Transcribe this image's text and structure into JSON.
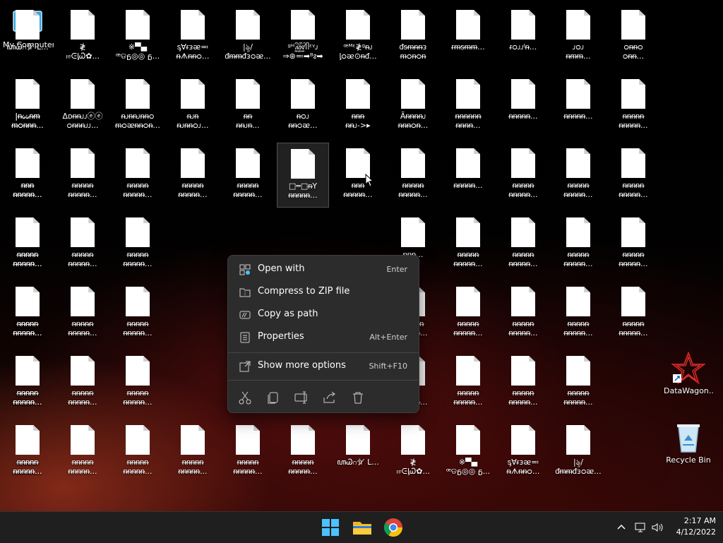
{
  "colors": {
    "accent": "#4cc2ff",
    "menu_bg": "#2c2c2c",
    "taskbar_bg": "#1f1f1f"
  },
  "desktop": {
    "special": [
      {
        "key": "my-computer",
        "label": "My Computer",
        "icon": "monitor-icon"
      },
      {
        "key": "datawagon",
        "label": "DataWagon...",
        "icon": "datawagon-shortcut-icon"
      },
      {
        "key": "recycle-bin",
        "label": "Recycle Bin",
        "icon": "recycle-bin-icon"
      }
    ],
    "files": [
      "ꦲᏊဂ݅ᥟ ̸ ᒪ...",
      "≹\nஈᕮᶅᏇ✿...",
      "※▀▄\nꟹଡᵷ◎◎ ᵷ...",
      "ᶊ∀ᵲᴈᴂ≕\nᵰᗑᵰᵰᴑ...",
      "|ৡ/\nᵭᵯᵯᵭᴈᴑᴂ...",
      "ᵍᴴ꫞ᥥᵋᵞᴊ\n⇒⊛≕➡ᴮᴤ➡",
      "ꟹᴹᵋ≹ᵍᵰᴊ\nᶅᴑᴂ⊙ᵰᵭ...",
      "ᵭᵴᵯᵰᵰᴈ\nᵯᴑᵰᴑᵰ",
      "ᵲᵯᵴᵯᵯ...",
      "ᵲᴑᴊᴊᴵᵰ...",
      "ᴊᴑᴊ\nᵰᵯᵯ...",
      "ᴑᵰᵰᴑ\nᴑᵰᵰ...",
      "|ᵰ᥀᥀ᵰᵯ\nᵯᴑᵰᵰᵰ...",
      "Δᴅᵰᵰᴊᴊⓔⓔ\nᴑᵰᵰᵰᴊᴊ...",
      "ᵰᴊᵰᵰᴊᵰᵰᴑ\nᵯᴑᴂᵰᵰᴑᵰ...",
      "ᵰᴊᵰ\nᵰᴊᵰᵰᴑᴊ...",
      "ᵰᵰ\nᵰᵰᴊᵰ...",
      "ᵰᴑᴊ\nᵰᵰᴑᴂ...",
      "ᵰᵰᵰ\nᵰᵰᴊ->▸",
      "Ãᵰᵰᵰᵰᴊ\nᵰᵰᵰᴑᵰ...",
      "ᵰᵰᵰᵰᵰᵰ\nᵰᵰᵰᵰ...",
      "ᵰᵰᵰᵰᵰ...",
      "ᵰᵰᵰᵰᵰ...",
      "ᵰᵰᵰᵰᵰ\nᵰᵰᵰᵰᵰ...",
      "ᵰᵰᵰ\nᵰᵰᵰᵰᵰ...",
      "ᵰᵰᵰᵰᵰ\nᵰᵰᵰᵰᵰ...",
      "ᵰᵰᵰᵰᵰ\nᵰᵰᵰᵰᵰ...",
      "ᵰᵰᵰᵰᵰ\nᵰᵰᵰᵰᵰ...",
      "ᵰᵰᵰᵰᵰ\nᵰᵰᵰᵰᵰ...",
      "□═□ᵰY\nᵰᵰᵰᵰᵰ...",
      "ᵰᵰᵰ\nᵰᵰᵰᵰᵰ...",
      "ᵰᵰᵰᵰᵰ\nᵰᵰᵰᵰᵰ...",
      "ᵰᵰᵰᵰᵰ...",
      "ᵰᵰᵰᵰᵰ\nᵰᵰᵰᵰᵰ...",
      "ᵰᵰᵰᵰᵰ\nᵰᵰᵰᵰᵰ...",
      "ᵰᵰᵰᵰᵰ\nᵰᵰᵰᵰᵰ...",
      "ᵰᵰᵰᵰᵰ\nᵰᵰᵰᵰᵰ...",
      "ᵰᵰᵰᵰᵰ\nᵰᵰᵰᵰᵰ...",
      "ᵰᵰᵰᵰᵰ\nᵰᵰᵰᵰᵰ...",
      "ᵰᵰᵰᵰᵰ\nᵰᵰᵰᵰᵰ...",
      "ᵰᵰᵰ...",
      "ᵰᵰᵰ...",
      "ᵰᵰᵰ...",
      "ᵰᵰᵰ...",
      "ᵰᵰᵰᵰᵰ\nᵰᵰᵰᵰᵰ...",
      "ᵰᵰᵰᵰᵰ\nᵰᵰᵰᵰᵰ...",
      "ᵰᵰᵰᵰᵰ\nᵰᵰᵰᵰᵰ...",
      "ᵰᵰᵰᵰᵰ\nᵰᵰᵰᵰᵰ...",
      "ᵰᵰᵰᵰᵰ\nᵰᵰᵰᵰᵰ...",
      "ᵰᵰᵰᵰᵰ\nᵰᵰᵰᵰᵰ...",
      "ᵰᵰᵰᵰᵰ\nᵰᵰᵰᵰᵰ...",
      "ᵰᵰᵰᵰᵰ\nᵰᵰᵰᵰᵰ...",
      "ᵰᵰᵰᵰᵰ\nᵰᵰᵰᵰᵰ...",
      "ᵰᵰᵰᵰᵰ\nᵰᵰᵰᵰᵰ...",
      "ᵰᵰᵰᵰᵰ\nᵰᵰᵰᵰᵰ...",
      "ᵰᵰᵰᵰᵰ\nᵰᵰᵰᵰᵰ...",
      "ᵰᵰᵰᵰᵰ\nᵰᵰᵰᵰᵰ...",
      "ᵰᵰᵰᵰᵰ\nᵰᵰᵰᵰᵰ...",
      "ᵰᵰᵰᵰᵰ\nᵰᵰᵰᵰᵰ...",
      "ᵰᵰᵰᵰᵰ\nᵰᵰᵰᵰᵰ...",
      "ᵰᵰᵰᵰᵰ\nᵰᵰᵰᵰᵰ...",
      "ᵰᵰᵰᵰᵰ\nᵰᵰᵰᵰᵰ...",
      "ᵰᵰᵰᵰᵰ\nᵰᵰᵰᵰᵰ...",
      "ᵰᵰᵰᵰᵰ\nᵰᵰᵰᵰᵰ...",
      "ᵰᵰᵰᵰᵰ\nᵰᵰᵰᵰᵰ...",
      "DataWagon...",
      "ᵰᵰᵰᵰᵰ\nᵰᵰᵰᵰᵰ...",
      "≠\nᵰᵰᵰᵰᵰ...",
      "ᵰᵰᵰᵰᵰ\nᵰᵰᵰᵰᵰ...",
      "ᵰᵰᵰᵰᵰ\nᵰᵰᵰᵰᵰ...",
      "ᵰᵰᵰᵰᵰ\nᵰᵰᵰᵰᵰ...",
      "ᵰᵰᵰᵰᵰ\nᵰᵰᵰᵰᵰ...",
      "ᵰᵰᵰᵰᵰ\nᵰᵰᵰᵰᵰ...",
      "ᵰᵰᵰᵰᵰ\nᵰᵰᵰᵰᵰ...",
      "ᵰᵰᵰᵰᵰ\nᵰᵰᵰᵰᵰ...",
      "ᵰᵰᵰᵰᵰ\nᵰᵰᵰᵰᵰ...",
      "ᵰᵰᵰᵰᵰ\nᵰᵰᵰᵰᵰ..."
    ]
  },
  "context_menu": {
    "items": [
      {
        "label": "Open with",
        "shortcut": "Enter",
        "icon": "open-with-icon"
      },
      {
        "label": "Compress to ZIP file",
        "shortcut": "",
        "icon": "zip-folder-icon"
      },
      {
        "label": "Copy as path",
        "shortcut": "",
        "icon": "copy-path-icon"
      },
      {
        "label": "Properties",
        "shortcut": "Alt+Enter",
        "icon": "properties-icon"
      }
    ],
    "more": {
      "label": "Show more options",
      "shortcut": "Shift+F10",
      "icon": "more-options-icon"
    },
    "toolbar": [
      "cut-icon",
      "copy-icon",
      "rename-icon",
      "share-icon",
      "delete-icon"
    ]
  },
  "taskbar": {
    "apps": [
      "windows-start-icon",
      "file-explorer-icon",
      "chrome-icon"
    ],
    "tray": [
      "chevron-up-icon",
      "network-icon",
      "volume-icon"
    ],
    "time": "2:17 AM",
    "date": "4/12/2022"
  }
}
